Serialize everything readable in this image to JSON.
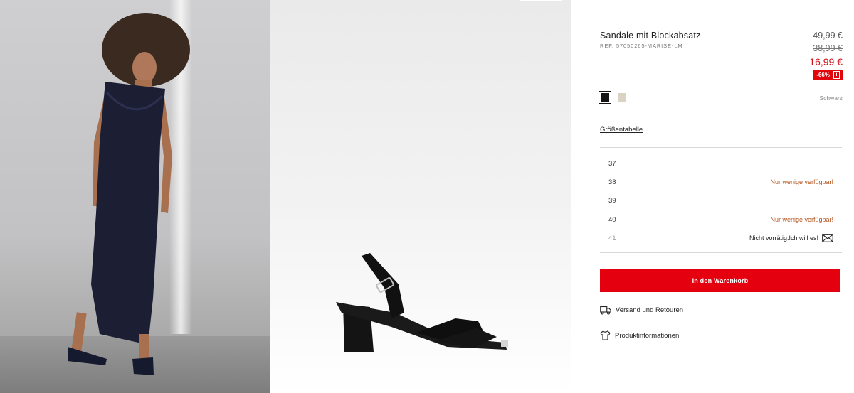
{
  "product": {
    "title": "Sandale mit Blockabsatz",
    "ref": "REF. 57050265-MARISE-LM"
  },
  "price": {
    "original": "49,99 €",
    "previous": "38,99 €",
    "current": "16,99 €",
    "discount": "-66%",
    "discount_info": "i"
  },
  "colors": {
    "selected_name": "Schwarz",
    "swatches": [
      "#151515",
      "#d9d3c3"
    ]
  },
  "size_guide_label": "Größentabelle",
  "sizes": [
    {
      "size": "37",
      "status": ""
    },
    {
      "size": "38",
      "status": "Nur wenige verfügbar!"
    },
    {
      "size": "39",
      "status": ""
    },
    {
      "size": "40",
      "status": "Nur wenige verfügbar!"
    },
    {
      "size": "41",
      "status": "Nicht vorrätig.Ich will es!"
    }
  ],
  "cart_button_label": "In den Warenkorb",
  "links": {
    "shipping": "Versand und Retouren",
    "product_info": "Produktinformationen"
  },
  "accent_colors": {
    "sale_red": "#d1131b",
    "cart_red": "#e4000f",
    "low_stock": "#b4541d"
  },
  "icons": [
    "envelope-icon",
    "truck-icon",
    "tshirt-icon"
  ]
}
